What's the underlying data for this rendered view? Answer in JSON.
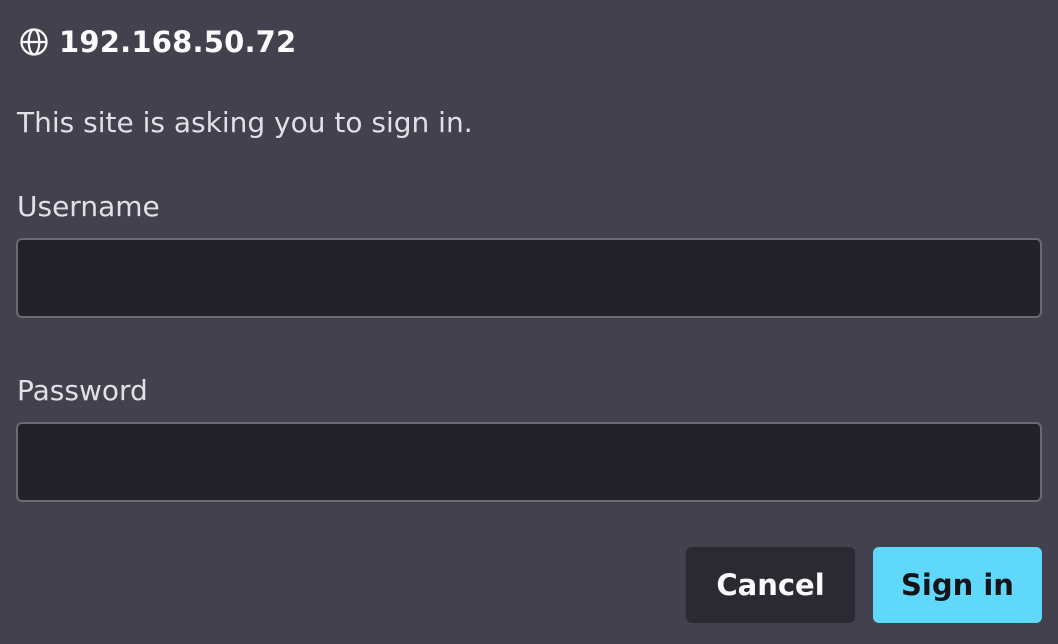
{
  "header": {
    "icon": "globe-icon",
    "host": "192.168.50.72"
  },
  "message": "This site is asking you to sign in.",
  "username": {
    "label": "Username",
    "value": "",
    "placeholder": ""
  },
  "password": {
    "label": "Password",
    "value": "",
    "placeholder": ""
  },
  "buttons": {
    "cancel": "Cancel",
    "sign_in": "Sign in"
  },
  "colors": {
    "background": "#42414d",
    "field_background": "#23222b",
    "primary_button": "#5fd8fa",
    "secondary_button": "#2b2a33"
  }
}
